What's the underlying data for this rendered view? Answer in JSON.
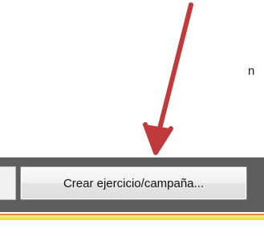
{
  "background_text_fragment": "n",
  "toolbar": {
    "create_button_label": "Crear ejercicio/campaña..."
  },
  "annotation": {
    "arrow_color": "#c0393b",
    "arrow_icon": "pointer-arrow-icon"
  },
  "colors": {
    "toolbar_bg": "#5e5e5e",
    "accent_yellow": "#e8da3a",
    "accent_orange": "#e8833a"
  }
}
